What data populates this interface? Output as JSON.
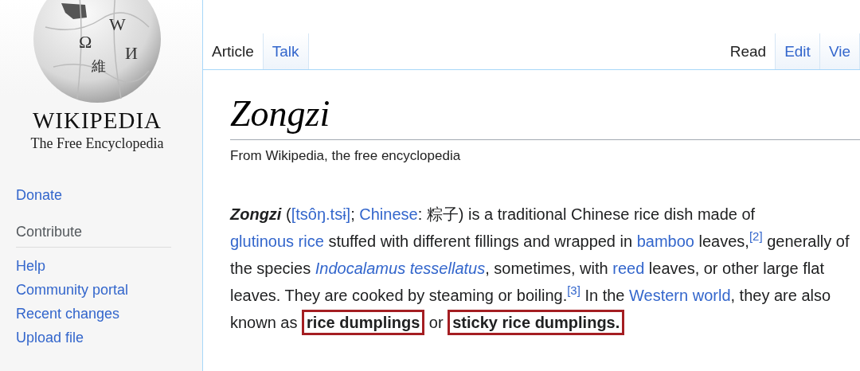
{
  "logo": {
    "glyphs": [
      "Ω",
      "W",
      "И",
      "維"
    ],
    "wordmark": "WIKIPEDIA",
    "tagline": "The Free Encyclopedia"
  },
  "sidebar": {
    "items": [
      {
        "kind": "link",
        "label": "Donate"
      },
      {
        "kind": "heading",
        "label": "Contribute"
      },
      {
        "kind": "link",
        "label": "Help"
      },
      {
        "kind": "link",
        "label": "Community portal"
      },
      {
        "kind": "link",
        "label": "Recent changes"
      },
      {
        "kind": "link",
        "label": "Upload file"
      }
    ]
  },
  "tabs": {
    "left": [
      {
        "label": "Article",
        "selected": true
      },
      {
        "label": "Talk",
        "selected": false
      }
    ],
    "right": [
      {
        "label": "Read",
        "selected": true
      },
      {
        "label": "Edit",
        "selected": false
      },
      {
        "label": "Vie",
        "selected": false
      }
    ]
  },
  "article": {
    "title": "Zongzi",
    "subtitle": "From Wikipedia, the free encyclopedia",
    "paragraph": [
      {
        "kind": "bold-italic",
        "text": "Zongzi"
      },
      {
        "kind": "text",
        "text": " ("
      },
      {
        "kind": "link",
        "text": "[tsôŋ.tsɨ]"
      },
      {
        "kind": "text",
        "text": "; "
      },
      {
        "kind": "link",
        "text": "Chinese"
      },
      {
        "kind": "text",
        "text": ": 粽子) is a traditional Chinese rice dish made of "
      },
      {
        "kind": "link",
        "text": "glutinous rice"
      },
      {
        "kind": "text",
        "text": " stuffed with different fillings and wrapped in "
      },
      {
        "kind": "link",
        "text": "bamboo"
      },
      {
        "kind": "text",
        "text": " leaves,"
      },
      {
        "kind": "ref",
        "text": "[2]"
      },
      {
        "kind": "text",
        "text": " generally of the species "
      },
      {
        "kind": "italic-link",
        "text": "Indocalamus tessellatus"
      },
      {
        "kind": "text",
        "text": ", sometimes, with "
      },
      {
        "kind": "link",
        "text": "reed"
      },
      {
        "kind": "text",
        "text": " leaves, or other large flat leaves. They are cooked by steaming or boiling."
      },
      {
        "kind": "ref",
        "text": "[3]"
      },
      {
        "kind": "text",
        "text": " In the "
      },
      {
        "kind": "link",
        "text": "Western world"
      },
      {
        "kind": "text",
        "text": ", they are also known as "
      },
      {
        "kind": "highlight",
        "text": "rice dumplings"
      },
      {
        "kind": "text",
        "text": " or "
      },
      {
        "kind": "highlight",
        "text": "sticky rice dumplings."
      }
    ]
  }
}
